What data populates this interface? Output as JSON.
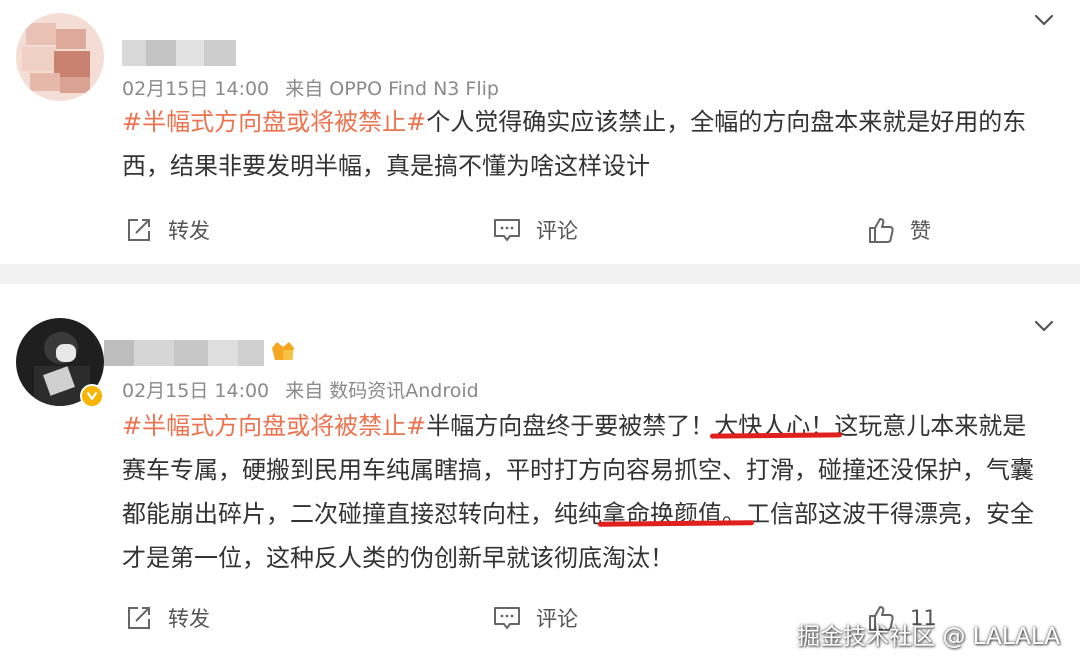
{
  "posts": [
    {
      "meta_date": "02月15日 14:00",
      "meta_source": "来自 OPPO Find N3 Flip",
      "topic": "#半幅式方向盘或将被禁止#",
      "text": "个人觉得确实应该禁止，全幅的方向盘本来就是好用的东西，结果非要发明半幅，真是搞不懂为啥这样设计",
      "actions": {
        "repost": "转发",
        "comment": "评论",
        "like": "赞"
      }
    },
    {
      "meta_date": "02月15日 14:00",
      "meta_source": "来自 数码资讯Android",
      "topic": "#半幅式方向盘或将被禁止#",
      "text_a": "半幅方向盘终于要被禁了！",
      "text_highlight_1": "大快人心！",
      "text_b": "这玩意儿本来就是赛车专属，硬搬到民用车纯属瞎搞，平时打方向容易抓空、打滑，碰撞还没保护，气囊都能崩出碎片，二次碰撞直接怼转向柱，纯纯",
      "text_highlight_2": "拿命换颜值。",
      "text_c": "工信部这波干得漂亮，安全才是第一位，这种反人类的伪创新早就该彻底淘汰！",
      "actions": {
        "repost": "转发",
        "comment": "评论",
        "like_count": "11"
      }
    }
  ],
  "watermark": "掘金技术社区 @ LALALA",
  "icons": [
    "repost-icon",
    "comment-icon",
    "like-icon",
    "chevron-down-icon",
    "verified-badge-icon",
    "fan-badge-icon"
  ],
  "colors": {
    "topic": "#eb7350",
    "meta": "#8a8a8a",
    "underline": "#e0201f",
    "separator": "#f2f2f2"
  }
}
